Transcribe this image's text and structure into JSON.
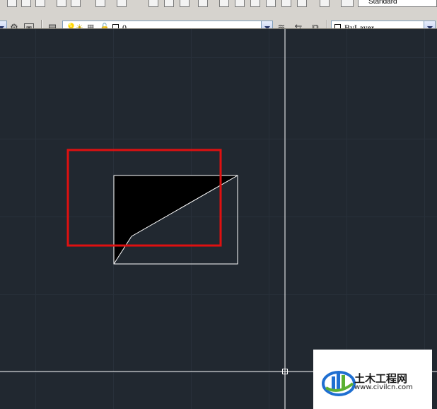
{
  "toolbar": {
    "text_style_value": "Standard",
    "layer_value": "0",
    "color_value": "ByLayer"
  },
  "watermark": {
    "title": "土木工程网",
    "url": "www.civilcn.com"
  },
  "colors": {
    "canvas_bg": "#212830",
    "geometry": "#ffffff",
    "highlight_box": "#e01010",
    "toolbar_bg": "#d6d3ce",
    "logo_blue": "#1f6fd1",
    "logo_green": "#5ab031"
  },
  "icons": [
    "cut-icon",
    "copy-icon",
    "paste-icon",
    "match-properties-icon",
    "undo-icon",
    "redo-icon",
    "pan-icon",
    "zoom-icon",
    "settings-icon",
    "layer-manager-icon",
    "bulb-icon",
    "sun-icon",
    "lock-icon",
    "layer-make-current-icon",
    "layer-previous-icon"
  ]
}
